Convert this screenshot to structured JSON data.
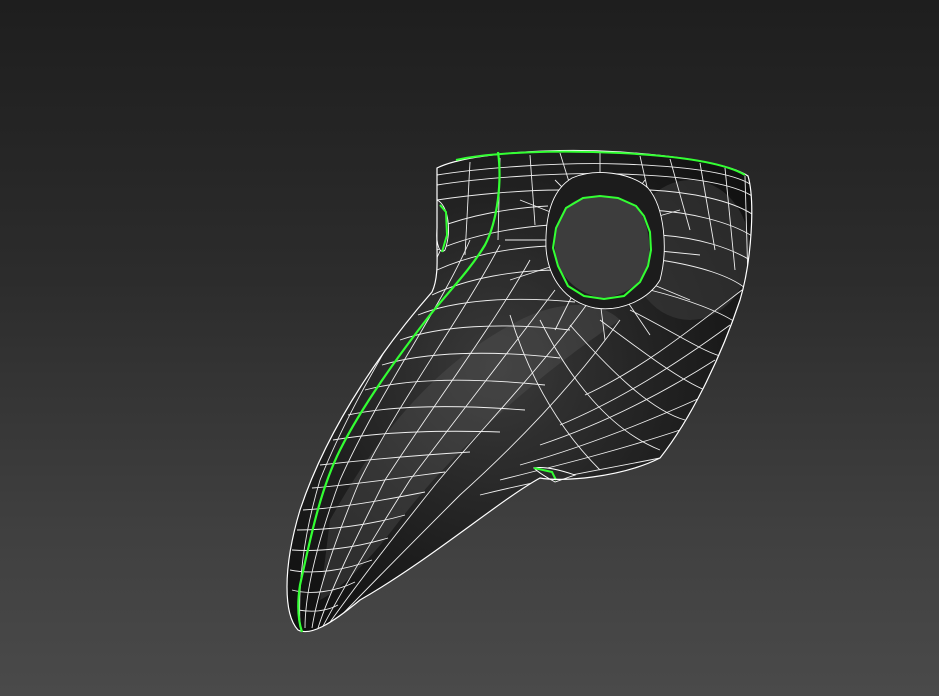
{
  "viewport": {
    "mode": "perspective",
    "shading": "default-shading-with-edged-faces",
    "background_top": "#1e1e1e",
    "background_bottom": "#4a4a4a"
  },
  "model": {
    "type": "plague-doctor-beak-mask",
    "surface_color": "#141414",
    "highlight_color": "#4c4c4c",
    "wire_color": "#ffffff",
    "selected_edge_color": "#33ff33",
    "selection": "edge-loops"
  }
}
